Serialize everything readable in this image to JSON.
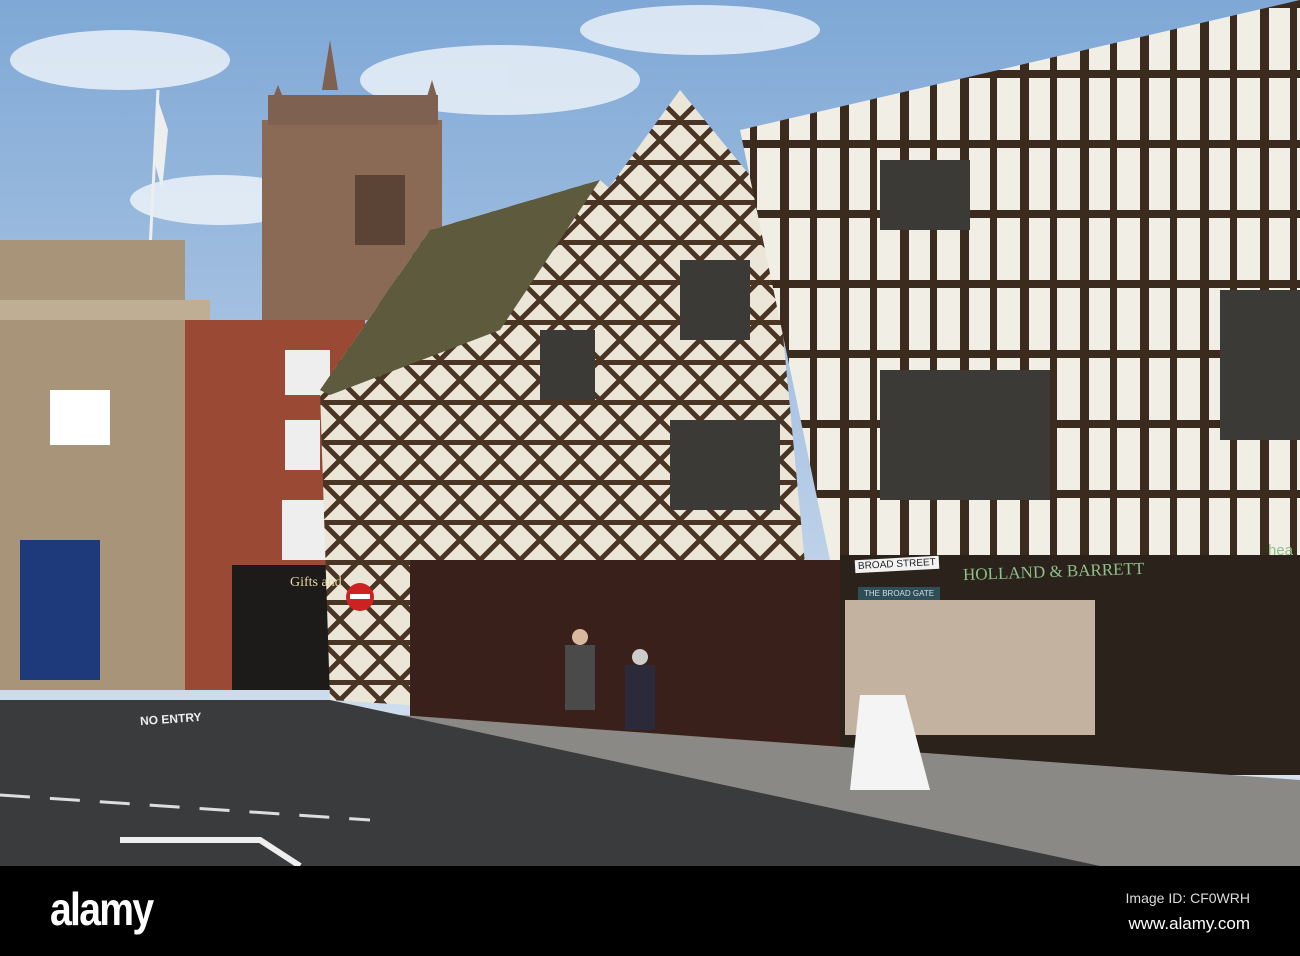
{
  "watermark": {
    "logo": "alamy",
    "image_id": "Image ID: CF0WRH",
    "site": "www.alamy.com"
  },
  "scene_text": {
    "shop_sign_gifts": "Gifts and",
    "street_sign": "BROAD STREET",
    "gate_sign": "THE BROAD GATE",
    "store_sign": "HOLLAND & BARRETT",
    "partial_sign": "hea",
    "road_marking": "NO ENTRY"
  },
  "colors": {
    "sky": "#a9c6e6",
    "timber": "#3b2a1e",
    "plaster": "#f2efe8",
    "brick": "#9a4a34",
    "stone": "#8f7a66",
    "store_green": "#8fbf8a"
  }
}
